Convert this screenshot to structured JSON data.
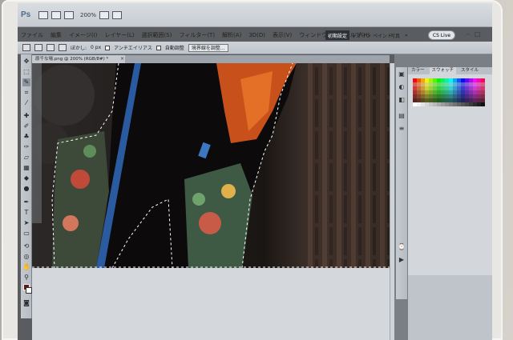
{
  "app": {
    "logo": "Ps",
    "zoom_display": "200%"
  },
  "menus": [
    "ファイル",
    "編集",
    "イメージ(I)",
    "レイヤー(L)",
    "選択範囲(S)",
    "フィルター(T)",
    "解析(A)",
    "3D(D)",
    "表示(V)",
    "ウィンドウ(W)",
    "ヘルプ(H)"
  ],
  "workspace": {
    "active": "初期設定",
    "others": [
      "デザイン",
      "ペイント",
      "写真"
    ],
    "more": "»",
    "cslive": "CS Live"
  },
  "options_bar": {
    "feather_label": "ぼかし:",
    "feather_value": "0 px",
    "antialias_label": "アンチエイリアス",
    "auto_enhance_label": "自動調整",
    "refine_edge_button": "境界線を調整..."
  },
  "document": {
    "tab_title": "原千な場.png @ 200% (RGB/8#) *",
    "tab_close": "×"
  },
  "swatches_panel": {
    "tabs": [
      "カラー",
      "スウォッチ",
      "スタイル"
    ],
    "active_tab_index": 1
  },
  "colors": {
    "foreground": "#5b1c12",
    "background": "#ffffff",
    "workspace_active": "#2d3036"
  },
  "icons": {
    "tools": [
      "move-tool",
      "marquee-tool",
      "quick-selection-tool",
      "crop-tool",
      "eyedropper-tool",
      "healing-brush-tool",
      "brush-tool",
      "clone-stamp-tool",
      "history-brush-tool",
      "eraser-tool",
      "gradient-tool",
      "blur-tool",
      "dodge-tool",
      "pen-tool",
      "type-tool",
      "path-selection-tool",
      "rectangle-tool",
      "3d-rotate-tool",
      "3d-orbit-tool",
      "hand-tool",
      "zoom-tool"
    ]
  }
}
